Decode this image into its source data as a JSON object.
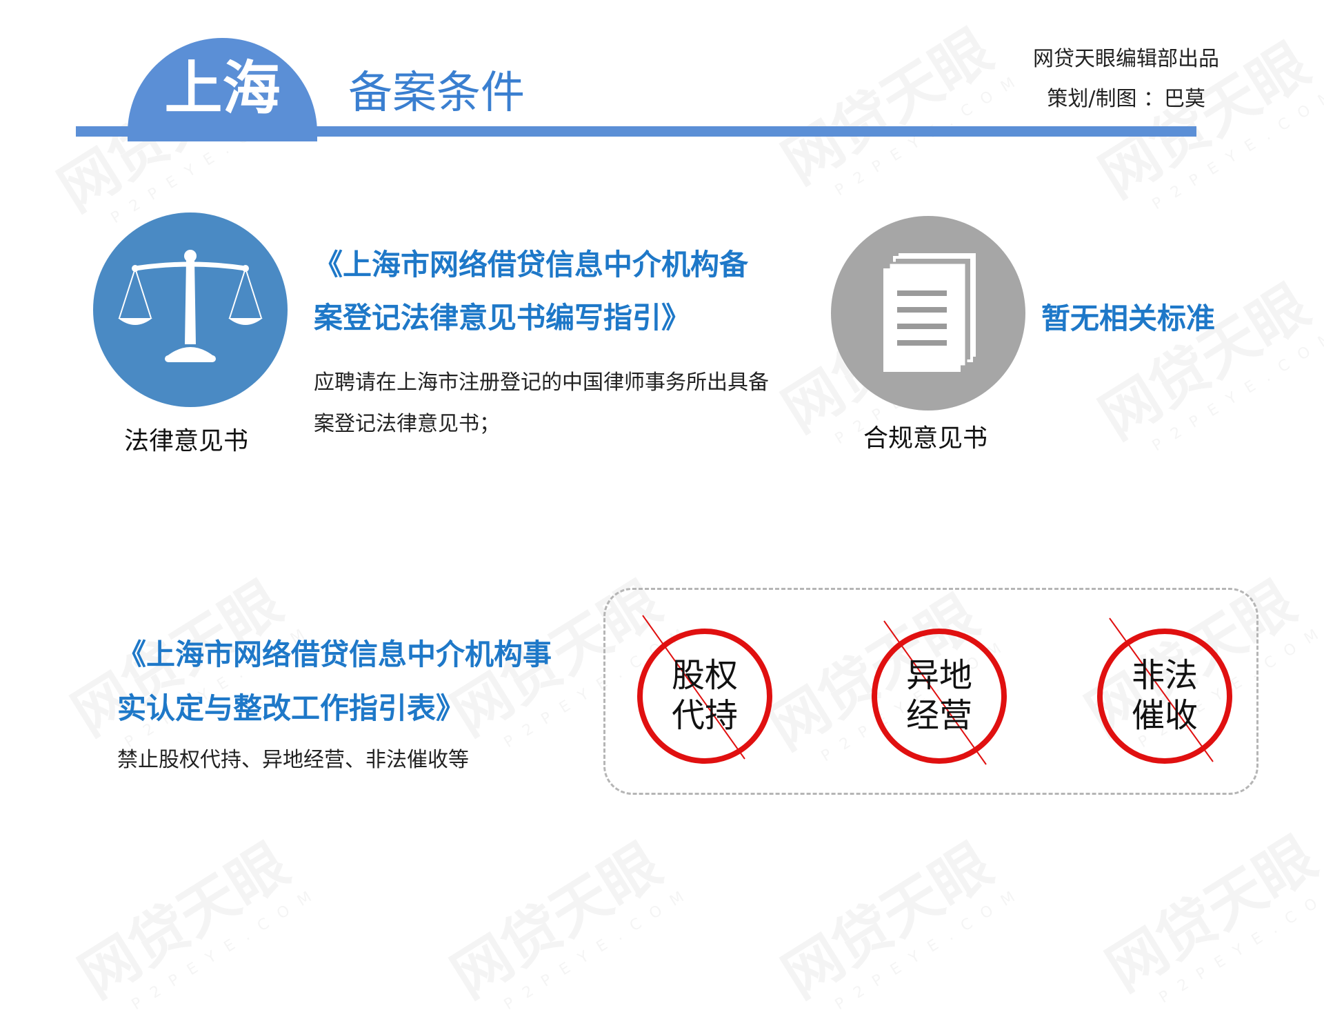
{
  "header": {
    "city": "上海",
    "title": "备案条件",
    "publisher": "网贷天眼编辑部出品",
    "credit": "策划/制图 ：巴莫"
  },
  "watermark": {
    "brand": "网贷天眼",
    "domain": "P2PEYE.COM"
  },
  "requirements": [
    {
      "icon": "scales-of-justice-icon",
      "caption": "法律意见书",
      "doc_title": "《上海市网络借贷信息中介机构备案登记法律意见书编写指引》",
      "description": "应聘请在上海市注册登记的中国律师事务所出具备案登记法律意见书；"
    },
    {
      "icon": "documents-icon",
      "caption": "合规意见书",
      "status": "暂无相关标准"
    }
  ],
  "rectification": {
    "doc_title": "《上海市网络借贷信息中介机构事实认定与整改工作指引表》",
    "description": "禁止股权代持、异地经营、非法催收等",
    "prohibited": [
      {
        "line1": "股权",
        "line2": "代持"
      },
      {
        "line1": "异地",
        "line2": "经营"
      },
      {
        "line1": "非法",
        "line2": "催收"
      }
    ]
  },
  "colors": {
    "header_blue": "#5b8fd6",
    "title_blue": "#1e78c8",
    "icon_blue": "#4a8ac4",
    "icon_gray": "#a6a6a6",
    "ban_red": "#e01010"
  }
}
